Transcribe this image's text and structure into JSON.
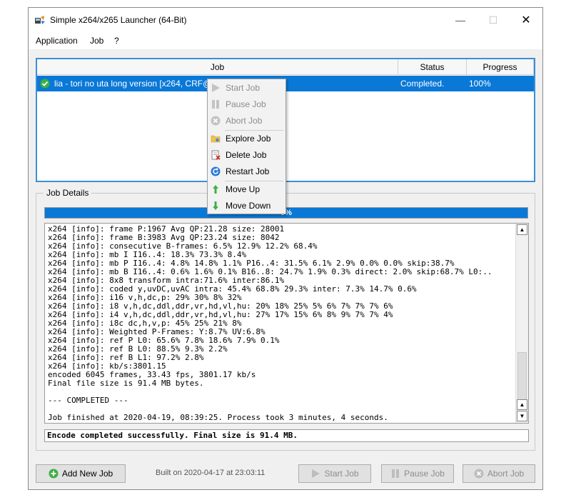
{
  "window": {
    "title": "Simple x264/x265 Launcher (64-Bit)",
    "minimize": "—",
    "maximize": "☐",
    "close": "✕"
  },
  "menu": {
    "items": [
      "Application",
      "Job",
      "?"
    ]
  },
  "jobs_table": {
    "headers": {
      "job": "Job",
      "status": "Status",
      "progress": "Progress"
    },
    "rows": [
      {
        "job": "lia - tori no uta long version [x264, CRF@",
        "status": "Completed.",
        "progress": "100%",
        "icon": "check-circle-icon"
      }
    ]
  },
  "context_menu": {
    "items": [
      {
        "label": "Start Job",
        "icon": "play-icon",
        "enabled": false
      },
      {
        "label": "Pause Job",
        "icon": "pause-icon",
        "enabled": false
      },
      {
        "label": "Abort Job",
        "icon": "abort-icon",
        "enabled": false
      },
      {
        "label": "Explore Job",
        "icon": "folder-icon",
        "enabled": true
      },
      {
        "label": "Delete Job",
        "icon": "delete-icon",
        "enabled": true
      },
      {
        "label": "Restart Job",
        "icon": "restart-icon",
        "enabled": true
      },
      {
        "label": "Move Up",
        "icon": "arrow-up-icon",
        "enabled": true
      },
      {
        "label": "Move Down",
        "icon": "arrow-down-icon",
        "enabled": true
      }
    ]
  },
  "job_details": {
    "label": "Job Details",
    "progress_text": "0%",
    "progress_value": 1.0,
    "log_lines": [
      "x264 [info]: frame P:1967 Avg QP:21.28 size: 28001",
      "x264 [info]: frame B:3983 Avg QP:23.24 size: 8042",
      "x264 [info]: consecutive B-frames: 6.5% 12.9% 12.2% 68.4%",
      "x264 [info]: mb I I16..4: 18.3% 73.3% 8.4%",
      "x264 [info]: mb P I16..4: 4.8% 14.8% 1.1% P16..4: 31.5% 6.1% 2.9% 0.0% 0.0% skip:38.7%",
      "x264 [info]: mb B I16..4: 0.6% 1.6% 0.1% B16..8: 24.7% 1.9% 0.3% direct: 2.0% skip:68.7% L0:..",
      "x264 [info]: 8x8 transform intra:71.6% inter:86.1%",
      "x264 [info]: coded y,uvDC,uvAC intra: 45.4% 68.8% 29.3% inter: 7.3% 14.7% 0.6%",
      "x264 [info]: i16 v,h,dc,p: 29% 30% 8% 32%",
      "x264 [info]: i8 v,h,dc,ddl,ddr,vr,hd,vl,hu: 20% 18% 25% 5% 6% 7% 7% 7% 6%",
      "x264 [info]: i4 v,h,dc,ddl,ddr,vr,hd,vl,hu: 27% 17% 15% 6% 8% 9% 7% 7% 4%",
      "x264 [info]: i8c dc,h,v,p: 45% 25% 21% 8%",
      "x264 [info]: Weighted P-Frames: Y:8.7% UV:6.8%",
      "x264 [info]: ref P L0: 65.6% 7.8% 18.6% 7.9% 0.1%",
      "x264 [info]: ref B L0: 88.5% 9.3% 2.2%",
      "x264 [info]: ref B L1: 97.2% 2.8%",
      "x264 [info]: kb/s:3801.15",
      "encoded 6045 frames, 33.43 fps, 3801.17 kb/s",
      "Final file size is 91.4 MB bytes.",
      "",
      "--- COMPLETED ---",
      "",
      "Job finished at 2020-04-19, 08:39:25. Process took 3 minutes, 4 seconds."
    ],
    "status_line": "Encode completed successfully. Final size is 91.4 MB."
  },
  "bottom": {
    "add_job": "Add New Job",
    "built_on": "Built on 2020-04-17 at 23:03:11",
    "start_job": "Start Job",
    "pause_job": "Pause Job",
    "abort_job": "Abort Job"
  },
  "colors": {
    "selection": "#0a78d7",
    "accent": "#3b8fd6",
    "check": "#3cb043"
  }
}
